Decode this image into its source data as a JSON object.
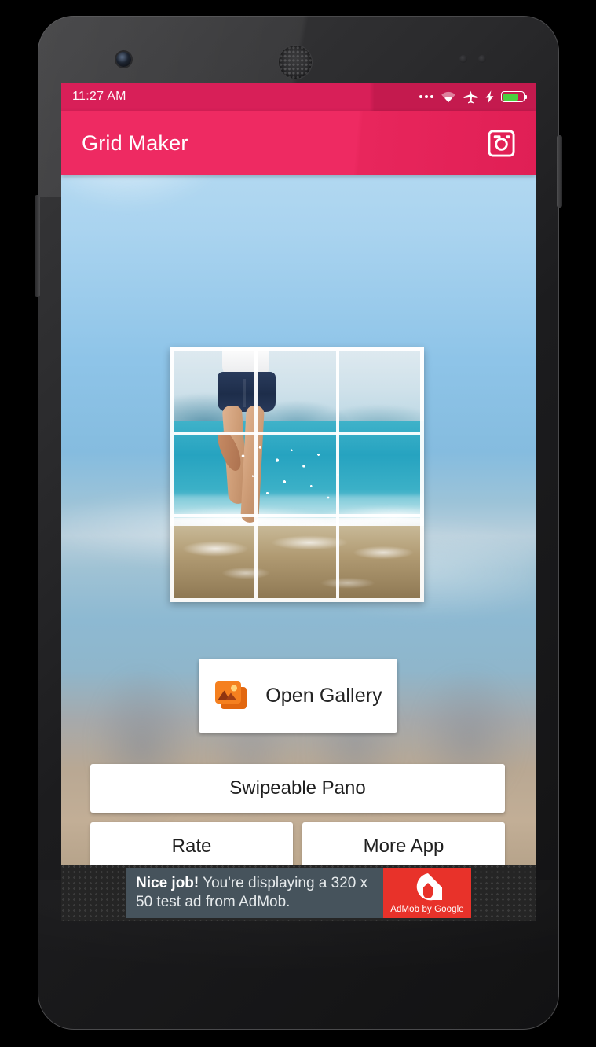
{
  "device": {
    "name": "android-phone",
    "hardware": {
      "front_camera": "front-camera",
      "earpiece": "earpiece-speaker",
      "sensor_left": "proximity-sensor",
      "sensor_right": "light-sensor",
      "power_button": "power-button",
      "volume_button": "volume-rocker"
    }
  },
  "status_bar": {
    "time": "11:27 AM",
    "icons": [
      "more-dots-icon",
      "wifi-icon",
      "airplane-mode-icon",
      "charging-bolt-icon",
      "battery-icon"
    ],
    "battery_level_percent": 78,
    "background_color": "#D81F58"
  },
  "app_bar": {
    "title": "Grid Maker",
    "action_icon": "instagram-icon",
    "background_color": "#EE2A62",
    "text_color": "#FFFFFF"
  },
  "preview": {
    "name": "grid-preview",
    "description": "Beach photo with 3x3 grid overlay",
    "grid_rows": 3,
    "grid_cols": 3,
    "grid_line_color": "#FFFFFF"
  },
  "buttons": {
    "open_gallery": {
      "label": "Open Gallery",
      "icon": "photo-library-icon",
      "icon_color": "#F2711C"
    },
    "swipeable_pano": {
      "label": "Swipeable Pano"
    },
    "rate": {
      "label": "Rate"
    },
    "more_app": {
      "label": "More App"
    }
  },
  "ad": {
    "headline": "Nice job!",
    "body": " You're displaying a 320 x 50 test ad from AdMob.",
    "logo_label": "AdMob by Google",
    "logo_mark": "admob-logo-icon",
    "logo_background_color": "#E8322A",
    "text_background_color": "#46535C",
    "size": "320 x 50"
  }
}
